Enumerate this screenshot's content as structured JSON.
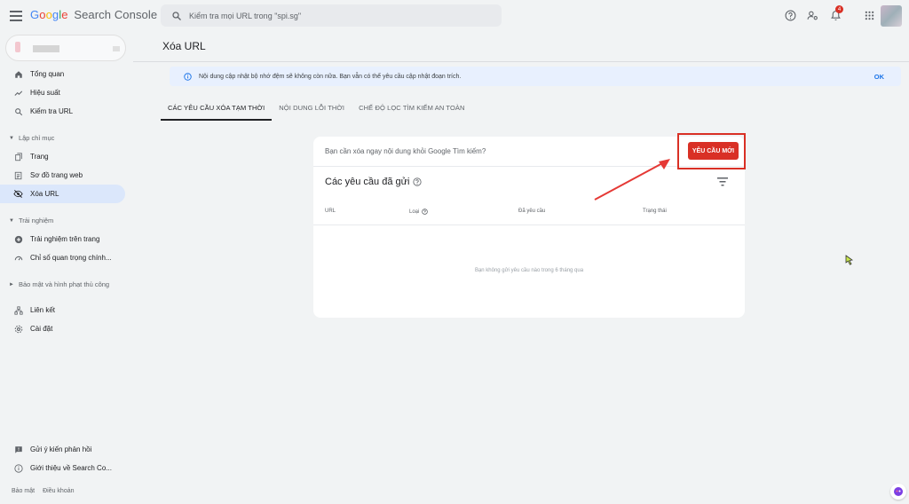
{
  "header": {
    "brand_google": [
      "G",
      "o",
      "o",
      "g",
      "l",
      "e"
    ],
    "brand_product": "Search Console",
    "search_placeholder": "Kiểm tra mọi URL trong \"spi.sg\"",
    "notification_count": "4"
  },
  "sidebar": {
    "items": [
      {
        "label": "Tổng quan",
        "icon": "home-icon"
      },
      {
        "label": "Hiệu suất",
        "icon": "trending-up-icon"
      },
      {
        "label": "Kiểm tra URL",
        "icon": "search-icon"
      }
    ],
    "section_index": "Lập chỉ mục",
    "index_items": [
      {
        "label": "Trang",
        "icon": "page-icon"
      },
      {
        "label": "Sơ đồ trang web",
        "icon": "sitemap-icon"
      },
      {
        "label": "Xóa URL",
        "icon": "eye-off-icon"
      }
    ],
    "section_experience": "Trải nghiệm",
    "experience_items": [
      {
        "label": "Trải nghiệm trên trang",
        "icon": "plus-circle-icon"
      },
      {
        "label": "Chỉ số quan trọng chính...",
        "icon": "speed-icon"
      }
    ],
    "section_security": "Bảo mật và hình phạt thủ công",
    "other_items": [
      {
        "label": "Liên kết",
        "icon": "links-icon"
      },
      {
        "label": "Cài đặt",
        "icon": "settings-icon"
      }
    ],
    "bottom_items": [
      {
        "label": "Gửi ý kiến phản hồi",
        "icon": "feedback-icon"
      },
      {
        "label": "Giới thiệu về Search Co...",
        "icon": "info-icon"
      }
    ],
    "footer": {
      "privacy": "Bảo mật",
      "terms": "Điều khoản"
    }
  },
  "main": {
    "title": "Xóa URL",
    "banner": {
      "text": "Nội dung cập nhật bộ nhớ đệm sẽ không còn nữa. Bạn vẫn có thể yêu cầu cập nhật đoạn trích.",
      "ok": "OK"
    },
    "tabs": [
      {
        "label": "CÁC YÊU CẦU XÓA TẠM THỜI",
        "active": true
      },
      {
        "label": "NỘI DUNG LỖI THỜI",
        "active": false
      },
      {
        "label": "CHẾ ĐỘ LỌC TÌM KIẾM AN TOÀN",
        "active": false
      }
    ],
    "card": {
      "question": "Bạn cần xóa ngay nội dung khỏi Google Tìm kiếm?",
      "new_request": "YÊU CẦU MỚI",
      "heading": "Các yêu cầu đã gửi",
      "columns": [
        "URL",
        "Loại",
        "Đã yêu cầu",
        "Trạng thái"
      ],
      "empty": "Bạn không gửi yêu cầu nào trong 6 tháng qua"
    }
  },
  "colors": {
    "accent_red": "#d93025",
    "active_nav": "#dbe7fb",
    "link_blue": "#1a73e8"
  }
}
